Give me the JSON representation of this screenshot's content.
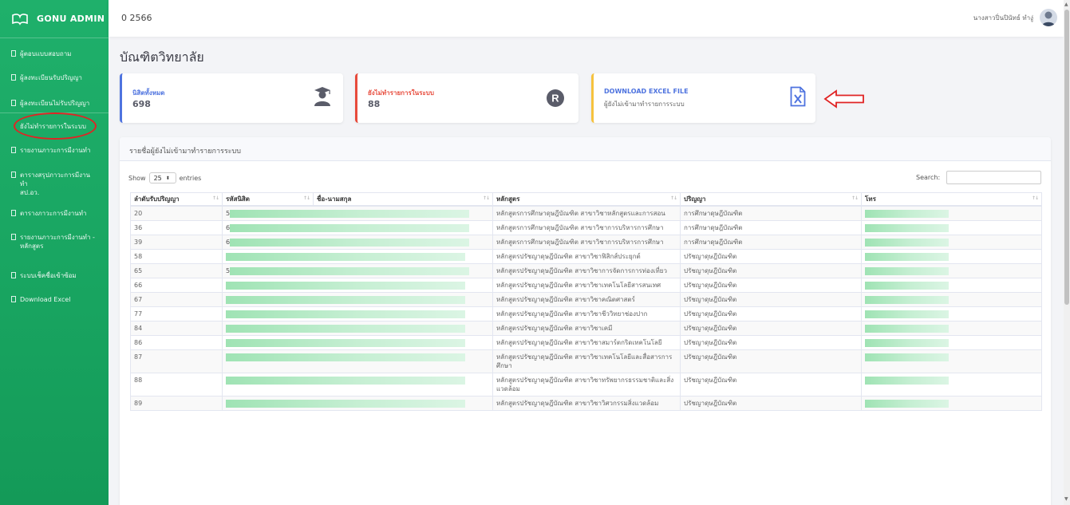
{
  "brand": {
    "name": "GONU ADMIN"
  },
  "sidebar": {
    "items": [
      {
        "label": "ผู้ตอบแบบสอบถาม"
      },
      {
        "label": "ผู้ลงทะเบียนรับปริญญา"
      },
      {
        "label": "ผู้ลงทะเบียนไม่รับปริญญา"
      },
      {
        "label": "ยังไม่ทำรายการในระบบ"
      },
      {
        "label": "รายงานภาวะการมีงานทำ"
      },
      {
        "label": "ตารางสรุปภาวะการมีงานทำ",
        "label2": "สป.อว."
      },
      {
        "label": "ตารางภาวะการมีงานทำ"
      },
      {
        "label": "รายงานภาวะการมีงานทำ -",
        "label2": "หลักสูตร"
      },
      {
        "label": "ระบบเช็คชื่อเข้าซ้อม"
      },
      {
        "label": "Download Excel"
      }
    ]
  },
  "topbar": {
    "title": "0 2566",
    "user": "นางสาวปิ่นปินัทธ์ ทำงู่"
  },
  "page": {
    "title": "บัณฑิตวิทยาลัย"
  },
  "cards": {
    "total": {
      "label": "นิสิตทั้งหมด",
      "value": "698"
    },
    "pending": {
      "label": "ยังไม่ทำรายการในระบบ",
      "value": "88"
    },
    "download": {
      "label": "DOWNLOAD EXCEL FILE",
      "sub": "ผู้ยังไม่เข้ามาทำรายการระบบ"
    }
  },
  "table_card": {
    "header": "รายชื่อผู้ยังไม่เข้ามาทำรายการระบบ",
    "show": "Show",
    "entries_value": "25",
    "entries": "entries",
    "search": "Search:",
    "columns": [
      "ลำดับรับปริญญา",
      "รหัสนิสิต",
      "ชื่อ-นามสกุล",
      "หลักสูตร",
      "ปริญญา",
      "โทร"
    ],
    "rows": [
      {
        "no": "20",
        "code": "5",
        "course": "หลักสูตรการศึกษาดุษฎีบัณฑิต สาขาวิชาหลักสูตรและการสอน",
        "degree": "การศึกษาดุษฎีบัณฑิต"
      },
      {
        "no": "36",
        "code": "6",
        "course": "หลักสูตรการศึกษาดุษฎีบัณฑิต สาขาวิชาการบริหารการศึกษา",
        "degree": "การศึกษาดุษฎีบัณฑิต"
      },
      {
        "no": "39",
        "code": "6",
        "course": "หลักสูตรการศึกษาดุษฎีบัณฑิต สาขาวิชาการบริหารการศึกษา",
        "degree": "การศึกษาดุษฎีบัณฑิต"
      },
      {
        "no": "58",
        "code": "",
        "course": "หลักสูตรปรัชญาดุษฎีบัณฑิต สาขาวิชาฟิสิกส์ประยุกต์",
        "degree": "ปรัชญาดุษฎีบัณฑิต"
      },
      {
        "no": "65",
        "code": "5",
        "course": "หลักสูตรปรัชญาดุษฎีบัณฑิต สาขาวิชาการจัดการการท่องเที่ยว",
        "degree": "ปรัชญาดุษฎีบัณฑิต"
      },
      {
        "no": "66",
        "code": "",
        "course": "หลักสูตรปรัชญาดุษฎีบัณฑิต สาขาวิชาเทคโนโลยีสารสนเทศ",
        "degree": "ปรัชญาดุษฎีบัณฑิต"
      },
      {
        "no": "67",
        "code": "",
        "course": "หลักสูตรปรัชญาดุษฎีบัณฑิต สาขาวิชาคณิตศาสตร์",
        "degree": "ปรัชญาดุษฎีบัณฑิต"
      },
      {
        "no": "77",
        "code": "",
        "course": "หลักสูตรปรัชญาดุษฎีบัณฑิต สาขาวิชาชีววิทยาช่องปาก",
        "degree": "ปรัชญาดุษฎีบัณฑิต"
      },
      {
        "no": "84",
        "code": "",
        "course": "หลักสูตรปรัชญาดุษฎีบัณฑิต สาขาวิชาเคมี",
        "degree": "ปรัชญาดุษฎีบัณฑิต"
      },
      {
        "no": "86",
        "code": "",
        "course": "หลักสูตรปรัชญาดุษฎีบัณฑิต สาขาวิชาสมาร์ตกริดเทคโนโลยี",
        "degree": "ปรัชญาดุษฎีบัณฑิต"
      },
      {
        "no": "87",
        "code": "",
        "course": "หลักสูตรปรัชญาดุษฎีบัณฑิต สาขาวิชาเทคโนโลยีและสื่อสารการศึกษา",
        "degree": "ปรัชญาดุษฎีบัณฑิต"
      },
      {
        "no": "88",
        "code": "",
        "course": "หลักสูตรปรัชญาดุษฎีบัณฑิต สาขาวิชาทรัพยากรธรรมชาติและสิ่งแวดล้อม",
        "degree": "ปรัชญาดุษฎีบัณฑิต"
      },
      {
        "no": "89",
        "code": "",
        "course": "หลักสูตรปรัชญาดุษฎีบัณฑิต สาขาวิชาวิศวกรรมสิ่งแวดล้อม",
        "degree": "ปรัชญาดุษฎีบัณฑิต"
      }
    ]
  },
  "colors": {
    "sidebar": "#1fb06b",
    "primary": "#4e73df",
    "danger": "#e74a3b",
    "warning": "#f6c23e",
    "annotation": "#e02424"
  },
  "icons": {
    "total": "graduate-icon",
    "pending": "registered-icon",
    "download": "excel-file-icon",
    "arrow": "left-arrow-icon"
  }
}
